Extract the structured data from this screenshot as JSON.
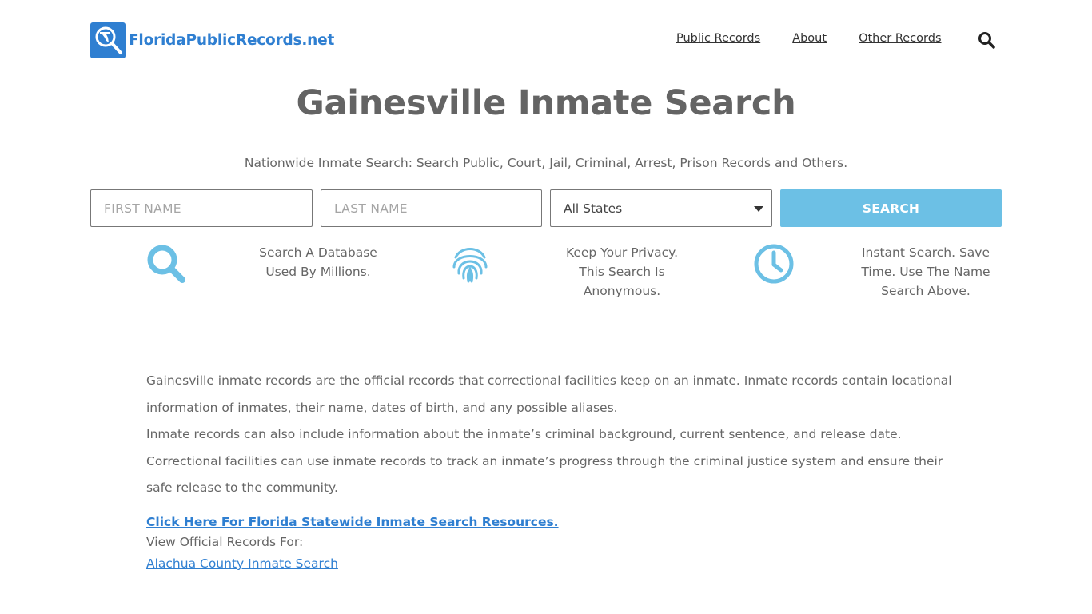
{
  "header": {
    "logo_text": "FloridaPublicRecords.net",
    "nav": [
      {
        "label": "Public Records"
      },
      {
        "label": "About"
      },
      {
        "label": "Other Records"
      }
    ]
  },
  "page": {
    "title": "Gainesville Inmate Search",
    "subtitle": "Nationwide Inmate Search: Search Public, Court, Jail, Criminal, Arrest, Prison Records and Others."
  },
  "form": {
    "first_name_placeholder": "FIRST NAME",
    "last_name_placeholder": "LAST NAME",
    "state_selected": "All States",
    "search_label": "SEARCH"
  },
  "features": [
    {
      "icon": "magnifier-icon",
      "text_lines": [
        "Search A Database",
        "Used By Millions."
      ]
    },
    {
      "icon": "fingerprint-icon",
      "text_lines": [
        "Keep Your Privacy.",
        "This Search Is",
        "Anonymous."
      ]
    },
    {
      "icon": "clock-icon",
      "text_lines": [
        "Instant Search. Save",
        "Time. Use The Name",
        "Search Above."
      ]
    }
  ],
  "content": {
    "paragraph_1": "Gainesville inmate records are the official records that correctional facilities keep on an inmate. Inmate records contain locational information of inmates, their name, dates of birth, and any possible aliases.",
    "paragraph_2": "Inmate records can also include information about the inmate’s criminal background, current sentence, and release date.",
    "paragraph_3": "Correctional facilities can use inmate records to track an inmate’s progress through the criminal justice system and ensure their safe release to the community.",
    "statewide_link": "Click Here For Florida Statewide Inmate Search Resources.",
    "view_records_label": "View Official Records For:",
    "county_link": "Alachua County Inmate Search"
  },
  "colors": {
    "brand_blue": "#2f7fd1",
    "accent_light_blue": "#6cc0e5",
    "title_gray": "#646464"
  }
}
